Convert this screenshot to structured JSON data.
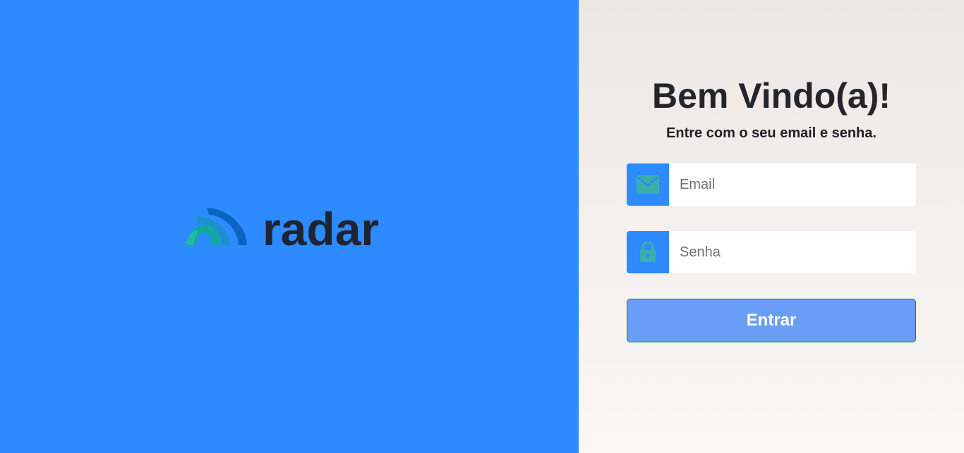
{
  "brand": {
    "name": "radar",
    "logo_icon": "radar-arcs-icon"
  },
  "login": {
    "title": "Bem Vindo(a)!",
    "subtitle": "Entre com o seu email e senha.",
    "email": {
      "placeholder": "Email",
      "value": "",
      "icon": "envelope-icon"
    },
    "password": {
      "placeholder": "Senha",
      "value": "",
      "icon": "lock-icon"
    },
    "submit_label": "Entrar"
  },
  "colors": {
    "brand_blue": "#2e8bff",
    "icon_teal": "#3aafa9",
    "button_blue": "#6a9df5",
    "text_dark": "#23252b"
  }
}
